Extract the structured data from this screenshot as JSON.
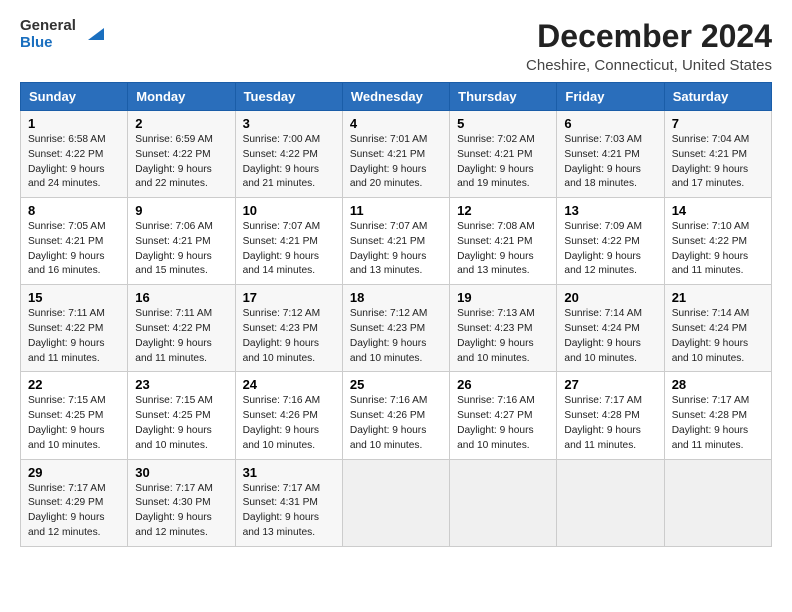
{
  "logo": {
    "line1": "General",
    "line2": "Blue"
  },
  "title": "December 2024",
  "subtitle": "Cheshire, Connecticut, United States",
  "days_of_week": [
    "Sunday",
    "Monday",
    "Tuesday",
    "Wednesday",
    "Thursday",
    "Friday",
    "Saturday"
  ],
  "weeks": [
    [
      {
        "day": 1,
        "sunrise": "6:58 AM",
        "sunset": "4:22 PM",
        "daylight": "9 hours and 24 minutes."
      },
      {
        "day": 2,
        "sunrise": "6:59 AM",
        "sunset": "4:22 PM",
        "daylight": "9 hours and 22 minutes."
      },
      {
        "day": 3,
        "sunrise": "7:00 AM",
        "sunset": "4:22 PM",
        "daylight": "9 hours and 21 minutes."
      },
      {
        "day": 4,
        "sunrise": "7:01 AM",
        "sunset": "4:21 PM",
        "daylight": "9 hours and 20 minutes."
      },
      {
        "day": 5,
        "sunrise": "7:02 AM",
        "sunset": "4:21 PM",
        "daylight": "9 hours and 19 minutes."
      },
      {
        "day": 6,
        "sunrise": "7:03 AM",
        "sunset": "4:21 PM",
        "daylight": "9 hours and 18 minutes."
      },
      {
        "day": 7,
        "sunrise": "7:04 AM",
        "sunset": "4:21 PM",
        "daylight": "9 hours and 17 minutes."
      }
    ],
    [
      {
        "day": 8,
        "sunrise": "7:05 AM",
        "sunset": "4:21 PM",
        "daylight": "9 hours and 16 minutes."
      },
      {
        "day": 9,
        "sunrise": "7:06 AM",
        "sunset": "4:21 PM",
        "daylight": "9 hours and 15 minutes."
      },
      {
        "day": 10,
        "sunrise": "7:07 AM",
        "sunset": "4:21 PM",
        "daylight": "9 hours and 14 minutes."
      },
      {
        "day": 11,
        "sunrise": "7:07 AM",
        "sunset": "4:21 PM",
        "daylight": "9 hours and 13 minutes."
      },
      {
        "day": 12,
        "sunrise": "7:08 AM",
        "sunset": "4:21 PM",
        "daylight": "9 hours and 13 minutes."
      },
      {
        "day": 13,
        "sunrise": "7:09 AM",
        "sunset": "4:22 PM",
        "daylight": "9 hours and 12 minutes."
      },
      {
        "day": 14,
        "sunrise": "7:10 AM",
        "sunset": "4:22 PM",
        "daylight": "9 hours and 11 minutes."
      }
    ],
    [
      {
        "day": 15,
        "sunrise": "7:11 AM",
        "sunset": "4:22 PM",
        "daylight": "9 hours and 11 minutes."
      },
      {
        "day": 16,
        "sunrise": "7:11 AM",
        "sunset": "4:22 PM",
        "daylight": "9 hours and 11 minutes."
      },
      {
        "day": 17,
        "sunrise": "7:12 AM",
        "sunset": "4:23 PM",
        "daylight": "9 hours and 10 minutes."
      },
      {
        "day": 18,
        "sunrise": "7:12 AM",
        "sunset": "4:23 PM",
        "daylight": "9 hours and 10 minutes."
      },
      {
        "day": 19,
        "sunrise": "7:13 AM",
        "sunset": "4:23 PM",
        "daylight": "9 hours and 10 minutes."
      },
      {
        "day": 20,
        "sunrise": "7:14 AM",
        "sunset": "4:24 PM",
        "daylight": "9 hours and 10 minutes."
      },
      {
        "day": 21,
        "sunrise": "7:14 AM",
        "sunset": "4:24 PM",
        "daylight": "9 hours and 10 minutes."
      }
    ],
    [
      {
        "day": 22,
        "sunrise": "7:15 AM",
        "sunset": "4:25 PM",
        "daylight": "9 hours and 10 minutes."
      },
      {
        "day": 23,
        "sunrise": "7:15 AM",
        "sunset": "4:25 PM",
        "daylight": "9 hours and 10 minutes."
      },
      {
        "day": 24,
        "sunrise": "7:16 AM",
        "sunset": "4:26 PM",
        "daylight": "9 hours and 10 minutes."
      },
      {
        "day": 25,
        "sunrise": "7:16 AM",
        "sunset": "4:26 PM",
        "daylight": "9 hours and 10 minutes."
      },
      {
        "day": 26,
        "sunrise": "7:16 AM",
        "sunset": "4:27 PM",
        "daylight": "9 hours and 10 minutes."
      },
      {
        "day": 27,
        "sunrise": "7:17 AM",
        "sunset": "4:28 PM",
        "daylight": "9 hours and 11 minutes."
      },
      {
        "day": 28,
        "sunrise": "7:17 AM",
        "sunset": "4:28 PM",
        "daylight": "9 hours and 11 minutes."
      }
    ],
    [
      {
        "day": 29,
        "sunrise": "7:17 AM",
        "sunset": "4:29 PM",
        "daylight": "9 hours and 12 minutes."
      },
      {
        "day": 30,
        "sunrise": "7:17 AM",
        "sunset": "4:30 PM",
        "daylight": "9 hours and 12 minutes."
      },
      {
        "day": 31,
        "sunrise": "7:17 AM",
        "sunset": "4:31 PM",
        "daylight": "9 hours and 13 minutes."
      },
      null,
      null,
      null,
      null
    ]
  ]
}
